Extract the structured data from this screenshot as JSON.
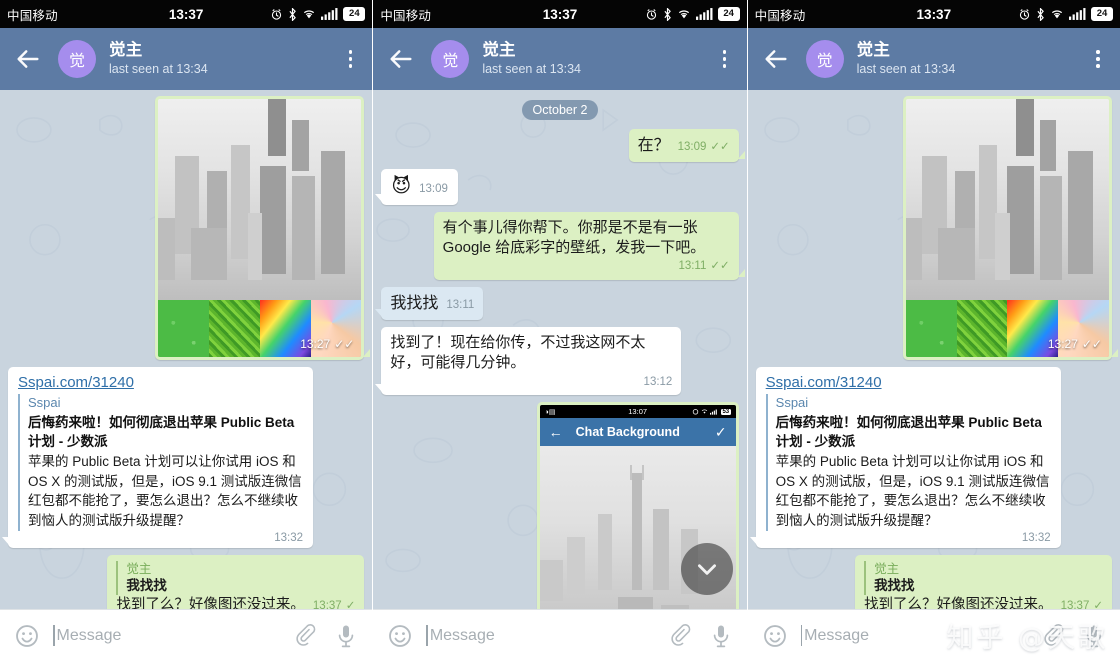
{
  "status_bar": {
    "carrier": "中国移动",
    "clock": "13:37",
    "battery": "24",
    "icons": [
      "alarm-icon",
      "bluetooth-icon",
      "wifi-icon",
      "signal-icon",
      "battery-icon"
    ]
  },
  "app_bar": {
    "back": "←",
    "avatar_letter": "觉",
    "name": "觉主",
    "subtitle": "last seen at 13:34",
    "menu": "⋮"
  },
  "composer": {
    "placeholder": "Message",
    "emoji_icon": "smiley-icon",
    "attach_icon": "paperclip-icon",
    "mic_icon": "microphone-icon"
  },
  "colors": {
    "header": "#5d7ba4",
    "avatar": "#a58ded",
    "chat_bg": "#c9d4de",
    "bubble_out": "#dcf0c3",
    "bubble_in": "#ffffff",
    "bubble_highlight": "#dbe8f2",
    "link": "#2f6fa8",
    "tick_read": "#5aa845"
  },
  "panels": [
    {
      "id": "panel-left",
      "messages": [
        {
          "kind": "photo",
          "side": "out",
          "time": "13:27",
          "ticks": "✓✓",
          "alt": "city-skyline-wallpaper-with-color-swatches"
        },
        {
          "kind": "link_preview",
          "side": "in",
          "link": "Sspai.com/31240",
          "site": "Sspai",
          "title": "后悔药来啦！如何彻底退出苹果 Public Beta 计划 - 少数派",
          "description": "苹果的 Public Beta 计划可以让你试用 iOS 和 OS X 的测试版，但是，iOS 9.1 测试版连微信红包都不能抢了，要怎么退出？怎么不继续收到恼人的测试版升级提醒？",
          "time": "13:32"
        },
        {
          "kind": "reply_text",
          "side": "out",
          "reply_name": "觉主",
          "reply_text": "我找找",
          "text": "找到了么？好像图还没过来。",
          "time": "13:37",
          "ticks": "✓"
        }
      ]
    },
    {
      "id": "panel-middle",
      "day_chip": "October 2",
      "messages": [
        {
          "kind": "text",
          "side": "out",
          "text": "在？",
          "time": "13:09",
          "ticks": "✓✓"
        },
        {
          "kind": "emoji",
          "side": "in",
          "emoji": "😈",
          "time": "13:09"
        },
        {
          "kind": "text",
          "side": "out",
          "text": "有个事儿得你帮下。你那是不是有一张 Google 给底彩字的壁纸，发我一下吧。",
          "time": "13:11",
          "ticks": "✓✓"
        },
        {
          "kind": "text",
          "side": "in",
          "text": "我找找",
          "time": "13:11",
          "highlight": true
        },
        {
          "kind": "text",
          "side": "in",
          "text": "找到了！现在给你传，不过我这网不太好，可能得几分钟。",
          "time": "13:12"
        },
        {
          "kind": "screenshot",
          "side": "out",
          "shot_clock": "13:07",
          "shot_battery": "53",
          "shot_title": "Chat Background",
          "shot_back": "←",
          "shot_check": "✓",
          "alt": "chat-background-settings-screenshot"
        }
      ],
      "scroll_button": "chevron-down-icon"
    },
    {
      "id": "panel-right",
      "messages": [
        {
          "kind": "photo",
          "side": "out",
          "time": "13:27",
          "ticks": "✓✓",
          "alt": "city-skyline-wallpaper-with-color-swatches"
        },
        {
          "kind": "link_preview",
          "side": "in",
          "link": "Sspai.com/31240",
          "site": "Sspai",
          "title": "后悔药来啦！如何彻底退出苹果 Public Beta 计划 - 少数派",
          "description": "苹果的 Public Beta 计划可以让你试用 iOS 和 OS X 的测试版，但是，iOS 9.1 测试版连微信红包都不能抢了，要怎么退出？怎么不继续收到恼人的测试版升级提醒？",
          "time": "13:32"
        },
        {
          "kind": "reply_text",
          "side": "out",
          "reply_name": "觉主",
          "reply_text": "我找找",
          "text": "找到了么？好像图还没过来。",
          "time": "13:37",
          "ticks": "✓"
        }
      ],
      "watermark": "知乎 @天歌"
    }
  ]
}
